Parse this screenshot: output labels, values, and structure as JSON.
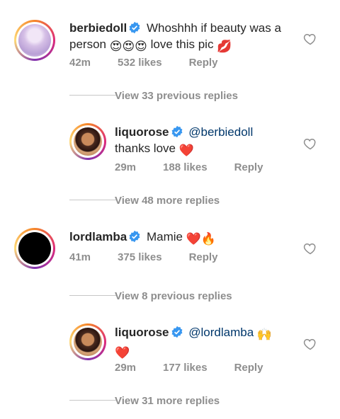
{
  "comments": [
    {
      "username": "berbiedoll",
      "text_line1": "Whoshhh if beauty was a",
      "text_line2_pre": "person",
      "text_line2_post": "love this pic",
      "time": "42m",
      "likes": "532 likes",
      "reply": "Reply"
    },
    {
      "view_label": "View 33 previous replies"
    },
    {
      "username": "liquorose",
      "mention": "@berbiedoll",
      "text_line2": "thanks love",
      "time": "29m",
      "likes": "188 likes",
      "reply": "Reply"
    },
    {
      "view_label": "View 48 more replies"
    },
    {
      "username": "lordlamba",
      "text": "Mamie",
      "time": "41m",
      "likes": "375 likes",
      "reply": "Reply"
    },
    {
      "view_label": "View 8 previous replies"
    },
    {
      "username": "liquorose",
      "mention": "@lordlamba",
      "time": "29m",
      "likes": "177 likes",
      "reply": "Reply"
    },
    {
      "view_label": "View 31 more replies"
    }
  ],
  "colors": {
    "verified_blue": "#3897f0",
    "heart_red": "#e0245e",
    "mention_blue": "#00376b",
    "meta_gray": "#8e8e8e"
  }
}
